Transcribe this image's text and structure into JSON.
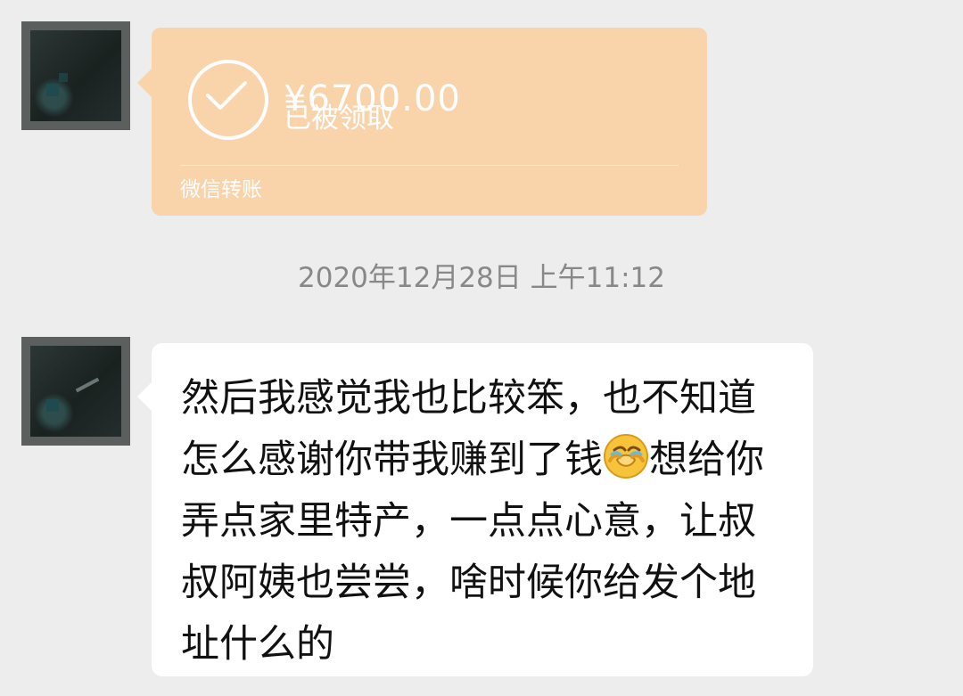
{
  "transfer": {
    "amount": "¥6700.00",
    "status": "已被领取",
    "label": "微信转账",
    "bubble_color": "#f9d4ab"
  },
  "timestamp": "2020年12月28日 上午11:12",
  "message": {
    "text_before_emoji": "然后我感觉我也比较笨，也不知道怎么感谢你带我赚到了钱",
    "emoji": "facepalm-emoji",
    "text_after_emoji": "想给你弄点家里特产，一点点心意，让叔叔阿姨也尝尝，啥时候你给发个地址什么的"
  },
  "icons": {
    "transfer_status_icon": "check-circle-icon",
    "avatar": "avatar"
  }
}
